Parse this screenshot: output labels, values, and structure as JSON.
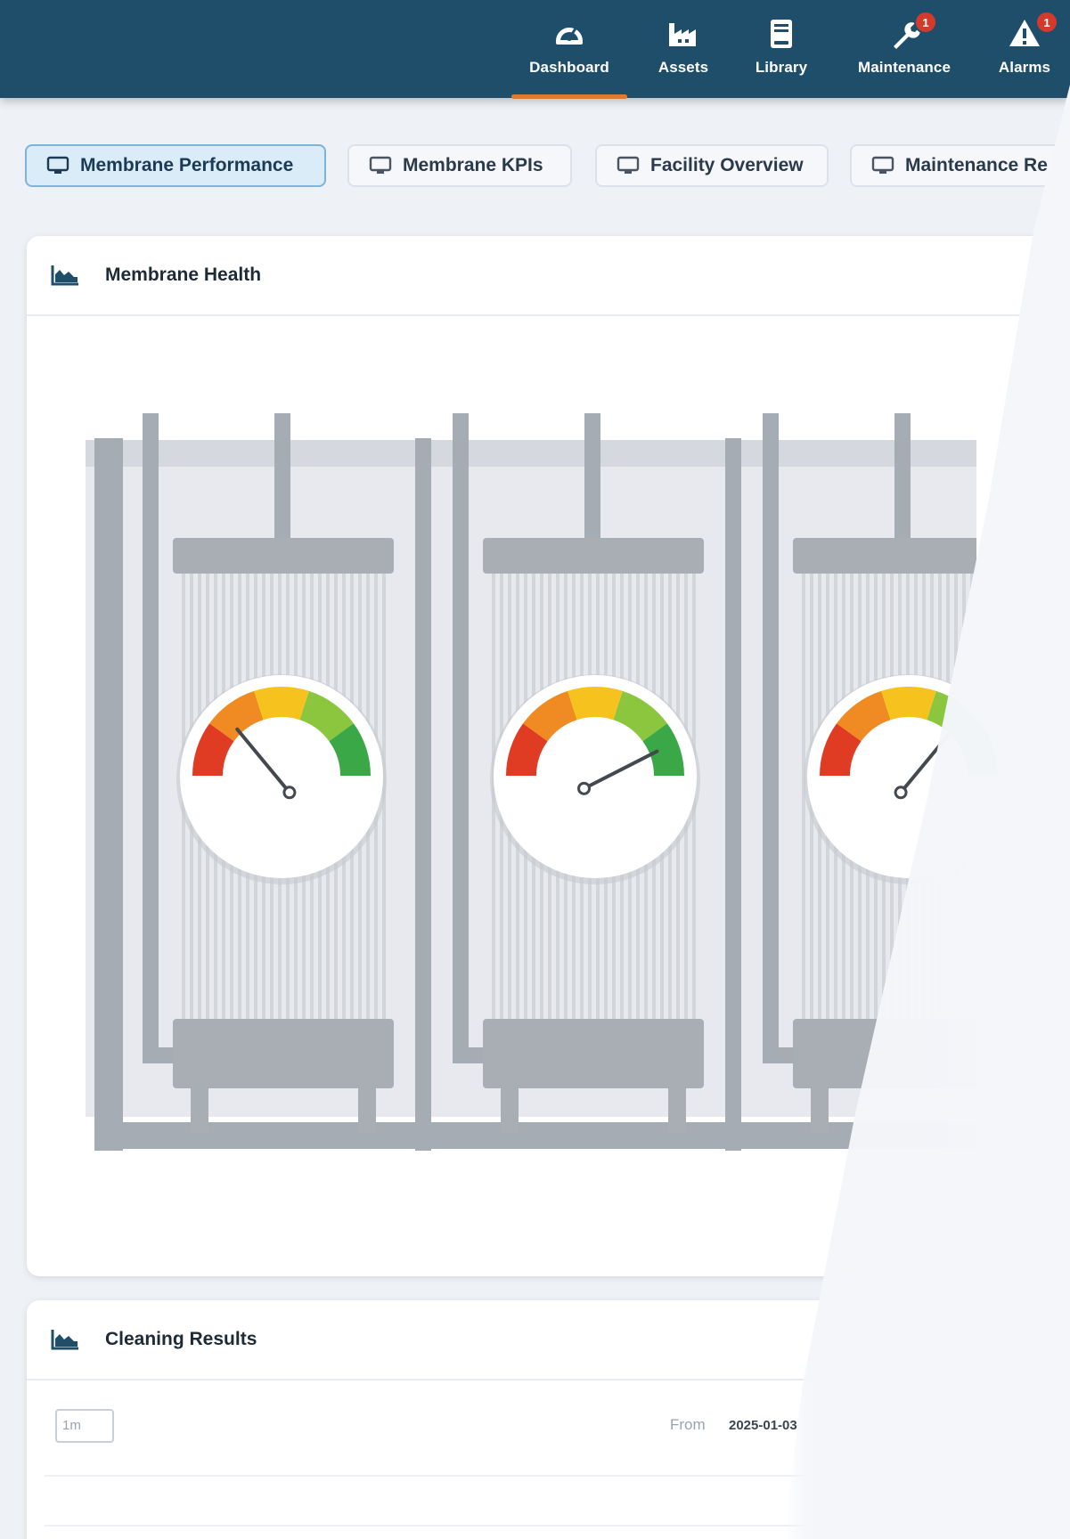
{
  "nav": {
    "items": [
      {
        "label": "Dashboard",
        "icon": "gauge-icon",
        "active": true
      },
      {
        "label": "Assets",
        "icon": "factory-icon"
      },
      {
        "label": "Library",
        "icon": "book-icon"
      },
      {
        "label": "Maintenance",
        "icon": "wrench-icon",
        "badge": "1"
      },
      {
        "label": "Alarms",
        "icon": "warning-icon",
        "badge": "1"
      }
    ]
  },
  "tabs": [
    {
      "label": "Membrane Performance",
      "active": true,
      "icon": "monitor-icon"
    },
    {
      "label": "Membrane KPIs",
      "icon": "monitor-icon"
    },
    {
      "label": "Facility Overview",
      "icon": "monitor-icon"
    },
    {
      "label": "Maintenance Re",
      "icon": "monitor-icon"
    }
  ],
  "membrane_health": {
    "title": "Membrane Health",
    "icon": "area-chart-icon",
    "gauges": [
      {
        "name": "membrane-1",
        "level": 0.28
      },
      {
        "name": "membrane-2",
        "level": 0.85
      },
      {
        "name": "membrane-3",
        "level": 0.72
      }
    ],
    "colors": {
      "red": "#e03c24",
      "orange": "#f08a22",
      "yellow": "#f6c21d",
      "lightgreen": "#8cc63f",
      "green": "#3aa846"
    }
  },
  "cleaning_results": {
    "title": "Cleaning Results",
    "icon": "area-chart-icon",
    "time_range": "1m",
    "from_label": "From",
    "from_value": "2025-01-03"
  },
  "colors": {
    "topbar": "#1f4e6b",
    "accent": "#e07a2b",
    "badge": "#d23a2c"
  }
}
